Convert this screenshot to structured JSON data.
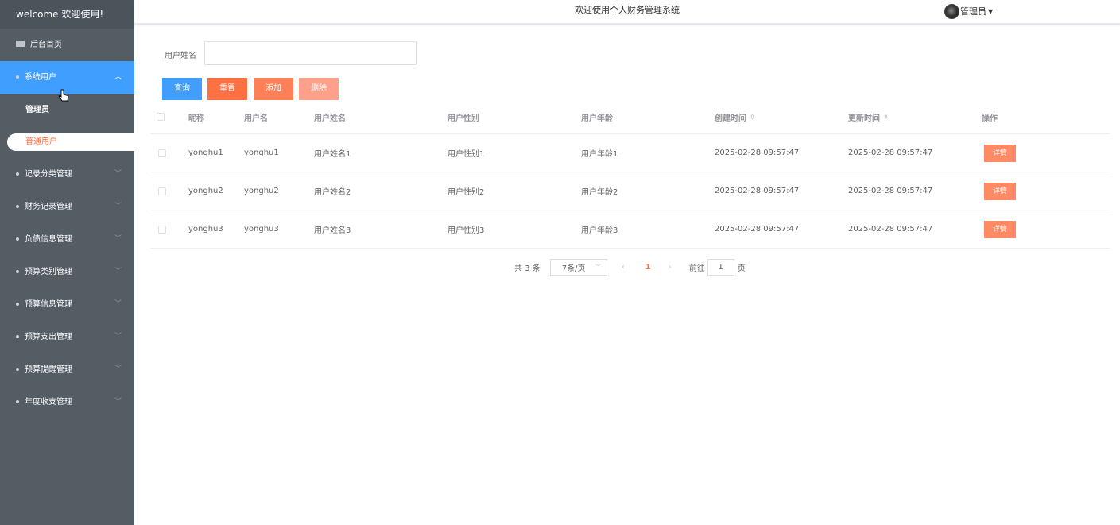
{
  "sidebar": {
    "brand": "welcome 欢迎使用!",
    "home": "后台首页",
    "system_users": "系统用户",
    "sub_items": [
      "管理员",
      "普通用户"
    ],
    "menus": [
      "记录分类管理",
      "财务记录管理",
      "负债信息管理",
      "预算类别管理",
      "预算信息管理",
      "预算支出管理",
      "预算提醒管理",
      "年度收支管理"
    ]
  },
  "header": {
    "title": "欢迎使用个人财务管理系统",
    "user": "管理员"
  },
  "search": {
    "label": "用户姓名",
    "value": "",
    "placeholder": ""
  },
  "buttons": {
    "query": "查询",
    "reset": "重置",
    "add": "添加",
    "delete": "删除"
  },
  "table": {
    "columns": [
      "昵称",
      "用户名",
      "用户姓名",
      "用户性别",
      "用户年龄",
      "创建时间",
      "更新时间",
      "操作"
    ],
    "rows": [
      [
        "yonghu1",
        "yonghu1",
        "用户姓名1",
        "用户性别1",
        "用户年龄1",
        "2025-02-28 09:57:47",
        "2025-02-28 09:57:47"
      ],
      [
        "yonghu2",
        "yonghu2",
        "用户姓名2",
        "用户性别2",
        "用户年龄2",
        "2025-02-28 09:57:47",
        "2025-02-28 09:57:47"
      ],
      [
        "yonghu3",
        "yonghu3",
        "用户姓名3",
        "用户性别3",
        "用户年龄3",
        "2025-02-28 09:57:47",
        "2025-02-28 09:57:47"
      ]
    ],
    "detail_label": "详情"
  },
  "pagination": {
    "total": "共 3 条",
    "page_size": "7条/页",
    "current_page": "1",
    "goto_label": "前往",
    "goto_value": "1",
    "goto_unit": "页"
  },
  "colors": {
    "sidebar_bg": "#545c64",
    "active": "#409eff",
    "accent": "#ff6a3d"
  }
}
